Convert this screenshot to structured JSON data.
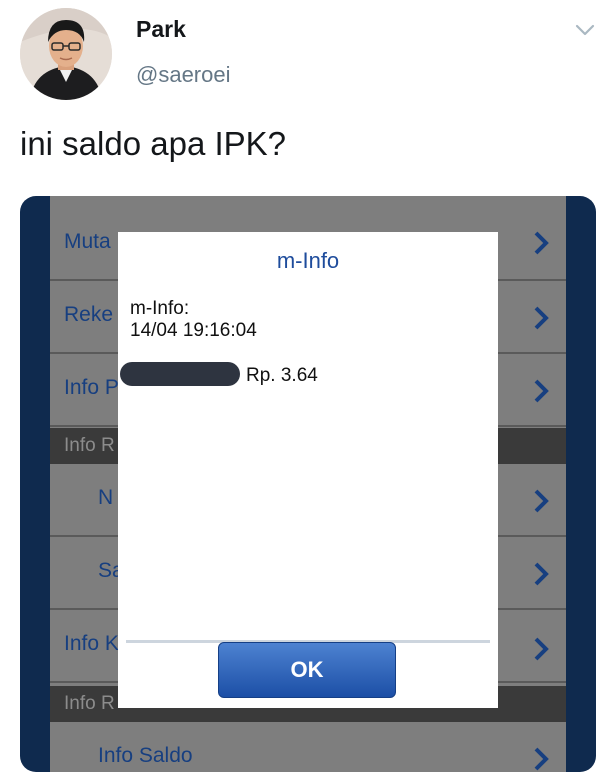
{
  "tweet": {
    "display_name": "Park",
    "handle": "@saeroei",
    "text": "ini saldo apa IPK?",
    "icons": {
      "avatar": "profile-photo",
      "caret": "chevron-down-icon"
    }
  },
  "screenshot": {
    "rows": [
      {
        "label": "Muta"
      },
      {
        "label": "Reke"
      },
      {
        "label": "Info P"
      },
      {
        "label": "N"
      },
      {
        "label": "Sa"
      },
      {
        "label": "Info K"
      },
      {
        "label": "Info Saldo"
      }
    ],
    "sections": [
      {
        "label": "Info R"
      },
      {
        "label": "Info R"
      }
    ],
    "chevron_icon": "chevron-right-icon",
    "dialog": {
      "title": "m-Info",
      "line1": "m-Info:",
      "line2": "14/04 19:16:04",
      "balance": "Rp. 3.64",
      "ok_label": "OK"
    }
  },
  "colors": {
    "link_blue": "#173f80",
    "dialog_title": "#1e4c9c",
    "ok_button": "#2a5fb8",
    "overlay": "#7e7e7e"
  }
}
